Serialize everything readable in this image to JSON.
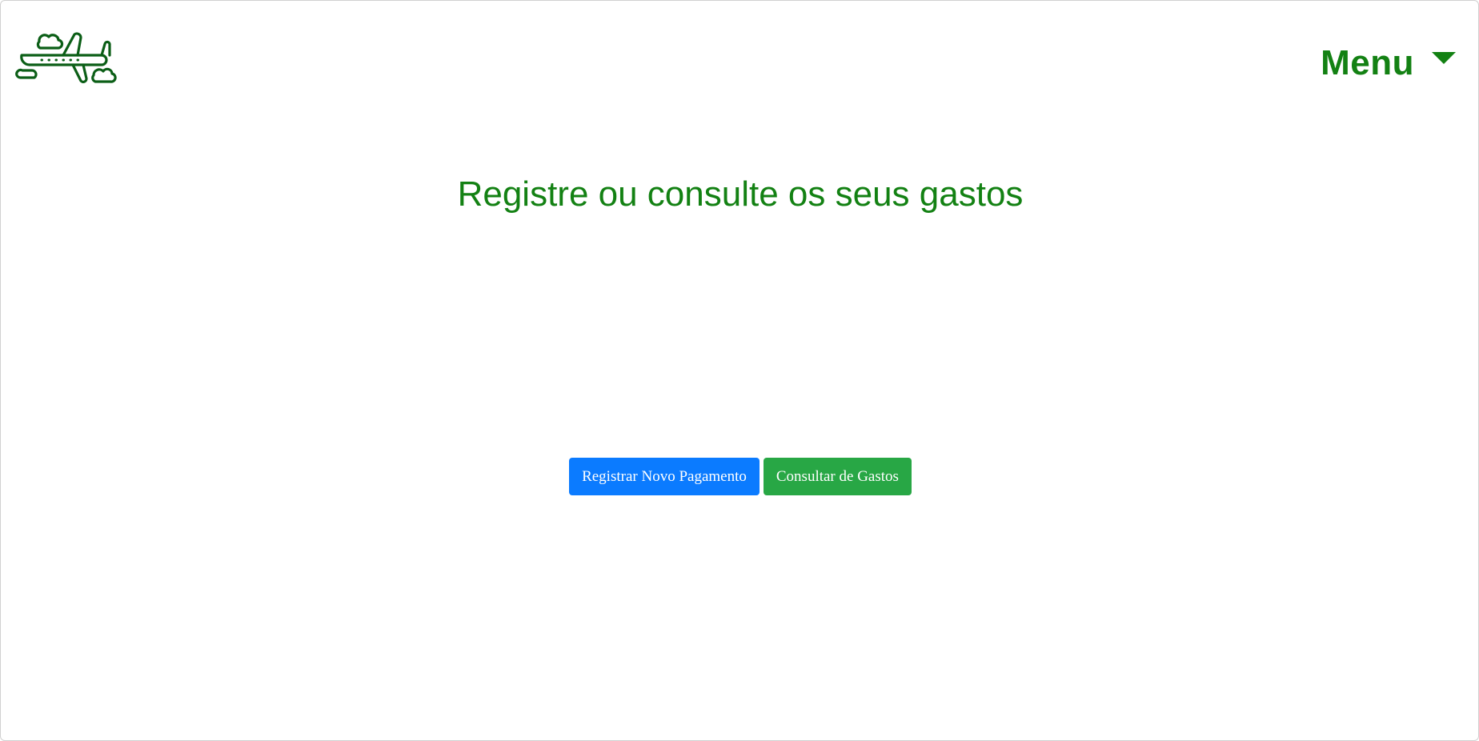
{
  "header": {
    "logo_icon": "airplane-clouds-icon",
    "menu_label": "Menu",
    "menu_caret_icon": "caret-down-icon"
  },
  "main": {
    "heading": "Registre ou consulte os seus gastos",
    "buttons": [
      {
        "label": "Registrar Novo Pagamento",
        "color": "#0b7bff"
      },
      {
        "label": "Consultar de Gastos",
        "color": "#28a745"
      }
    ]
  },
  "colors": {
    "accent": "#138113",
    "logo_stroke": "#0b5e16",
    "primary": "#0b7bff",
    "success": "#28a745"
  }
}
